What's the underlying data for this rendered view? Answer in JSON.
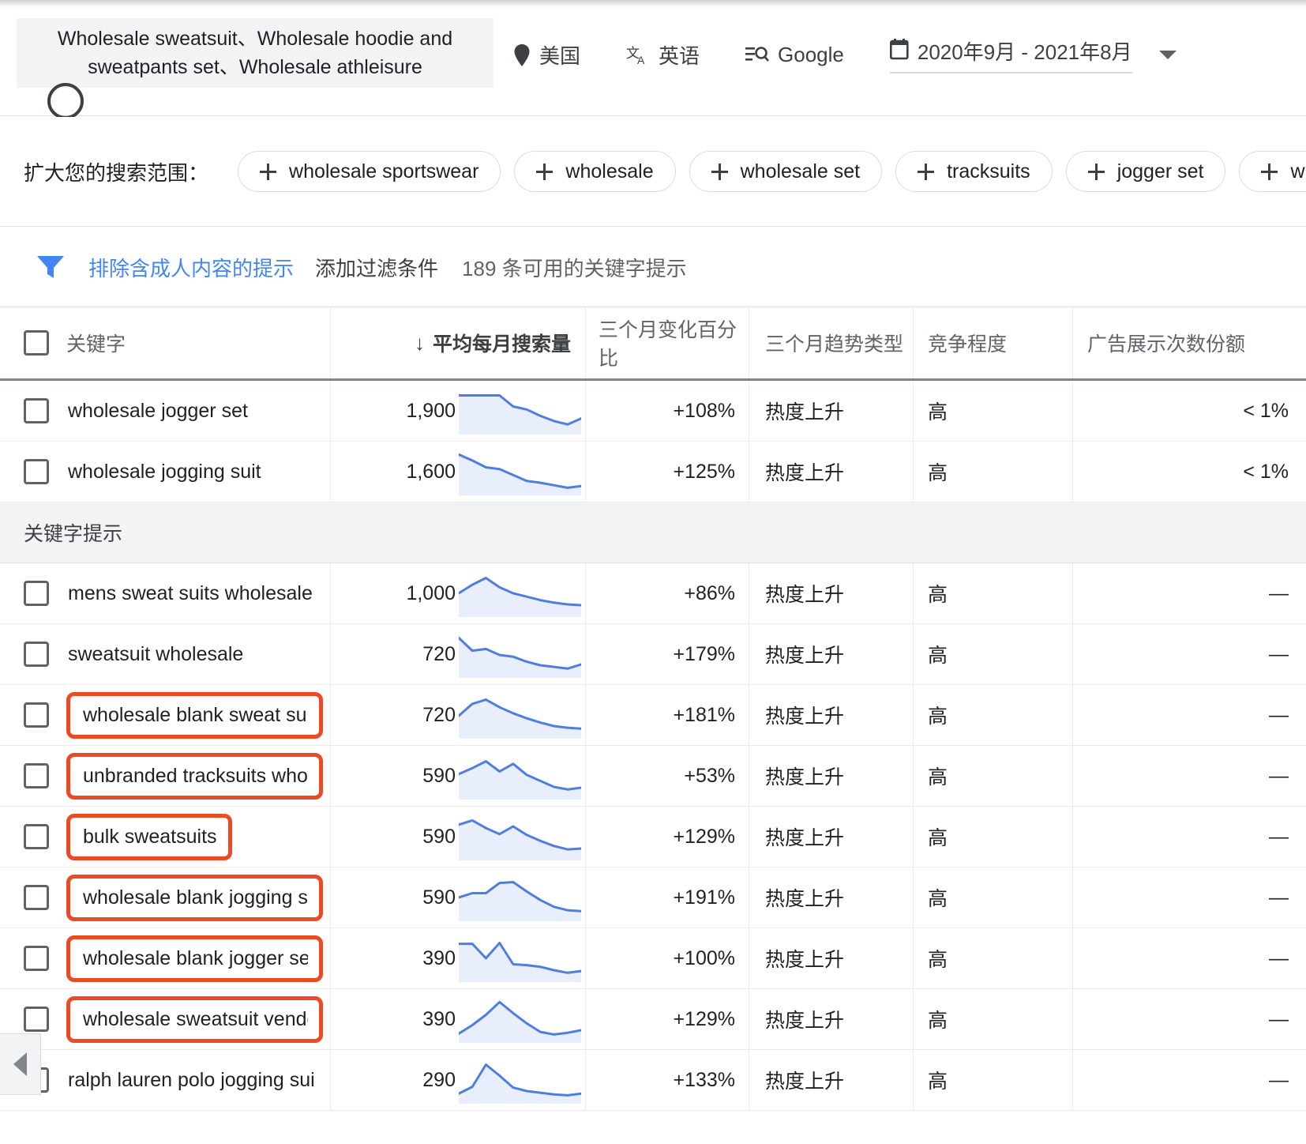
{
  "header": {
    "keyword_chip": "Wholesale sweatsuit、Wholesale hoodie and sweatpants set、Wholesale athleisure",
    "location": "美国",
    "language": "英语",
    "network": "Google",
    "date_range": "2020年9月 - 2021年8月",
    "location_icon": "location-pin-icon",
    "language_icon": "translate-icon",
    "network_icon": "search-network-icon",
    "date_icon": "calendar-icon",
    "dropdown_icon": "chevron-down-icon"
  },
  "expand": {
    "label": "扩大您的搜索范围：",
    "chips": [
      "wholesale sportswear",
      "wholesale",
      "wholesale set",
      "tracksuits",
      "jogger set",
      "whol"
    ]
  },
  "filters": {
    "filter_icon": "funnel-icon",
    "exclude_adult": "排除含成人内容的提示",
    "add_filter": "添加过滤条件",
    "available_count": "189 条可用的关键字提示"
  },
  "table": {
    "columns": {
      "keyword": "关键字",
      "avg_monthly_searches": "平均每月搜索量",
      "three_month_change": "三个月变化百分比",
      "three_month_trend": "三个月趋势类型",
      "competition": "竞争程度",
      "ad_impression_share": "广告展示次数份额"
    },
    "sort_icon": "arrow-down-icon",
    "section_label": "关键字提示",
    "rows_top": [
      {
        "keyword": "wholesale jogger set",
        "volume": "1,900",
        "change": "+108%",
        "trend": "热度上升",
        "competition": "高",
        "share": "< 1%",
        "highlighted": false,
        "spark": [
          88,
          88,
          88,
          88,
          62,
          55,
          40,
          28,
          20,
          34
        ]
      },
      {
        "keyword": "wholesale jogging suit",
        "volume": "1,600",
        "change": "+125%",
        "trend": "热度上升",
        "competition": "高",
        "share": "< 1%",
        "highlighted": false,
        "spark": [
          92,
          78,
          62,
          58,
          44,
          30,
          26,
          20,
          14,
          18
        ]
      }
    ],
    "rows_suggestions": [
      {
        "keyword": "mens sweat suits wholesale",
        "volume": "1,000",
        "change": "+86%",
        "trend": "热度上升",
        "competition": "高",
        "share": "—",
        "highlighted": false,
        "spark": [
          52,
          72,
          88,
          66,
          52,
          44,
          36,
          30,
          26,
          24
        ]
      },
      {
        "keyword": "sweatsuit wholesale",
        "volume": "720",
        "change": "+179%",
        "trend": "热度上升",
        "competition": "高",
        "share": "—",
        "highlighted": false,
        "spark": [
          90,
          60,
          64,
          50,
          46,
          34,
          26,
          22,
          18,
          28
        ]
      },
      {
        "keyword": "wholesale blank sweat suits",
        "volume": "720",
        "change": "+181%",
        "trend": "热度上升",
        "competition": "高",
        "share": "—",
        "highlighted": true,
        "spark": [
          50,
          78,
          88,
          70,
          56,
          44,
          34,
          26,
          22,
          20
        ]
      },
      {
        "keyword": "unbranded tracksuits whole..",
        "volume": "590",
        "change": "+53%",
        "trend": "热度上升",
        "competition": "高",
        "share": "—",
        "highlighted": true,
        "spark": [
          56,
          70,
          86,
          62,
          80,
          54,
          40,
          26,
          20,
          24
        ]
      },
      {
        "keyword": "bulk sweatsuits",
        "volume": "590",
        "change": "+129%",
        "trend": "热度上升",
        "competition": "高",
        "share": "—",
        "highlighted": true,
        "spark": [
          80,
          90,
          72,
          58,
          76,
          56,
          42,
          30,
          22,
          24
        ]
      },
      {
        "keyword": "wholesale blank jogging suits",
        "volume": "590",
        "change": "+191%",
        "trend": "热度上升",
        "competition": "高",
        "share": "—",
        "highlighted": true,
        "spark": [
          52,
          62,
          62,
          86,
          88,
          66,
          46,
          30,
          22,
          20
        ]
      },
      {
        "keyword": "wholesale blank jogger sets",
        "volume": "390",
        "change": "+100%",
        "trend": "热度上升",
        "competition": "高",
        "share": "—",
        "highlighted": true,
        "spark": [
          86,
          86,
          52,
          88,
          38,
          36,
          32,
          24,
          18,
          22
        ]
      },
      {
        "keyword": "wholesale sweatsuit vendors",
        "volume": "390",
        "change": "+129%",
        "trend": "热度上升",
        "competition": "高",
        "share": "—",
        "highlighted": true,
        "spark": [
          18,
          38,
          62,
          92,
          66,
          42,
          22,
          16,
          20,
          26
        ]
      },
      {
        "keyword": "ralph lauren polo jogging sui",
        "volume": "290",
        "change": "+133%",
        "trend": "热度上升",
        "competition": "高",
        "share": "—",
        "highlighted": false,
        "spark": [
          20,
          36,
          88,
          62,
          34,
          26,
          22,
          18,
          16,
          20
        ]
      }
    ]
  },
  "collapse_panel": {
    "icon": "triangle-left-icon"
  },
  "colors": {
    "accent_blue": "#4285f4",
    "spark_line": "#4e7fe0",
    "spark_fill": "#e8eefc",
    "annotation_red": "#ea4a26",
    "section_bg": "#f1f3f4"
  }
}
